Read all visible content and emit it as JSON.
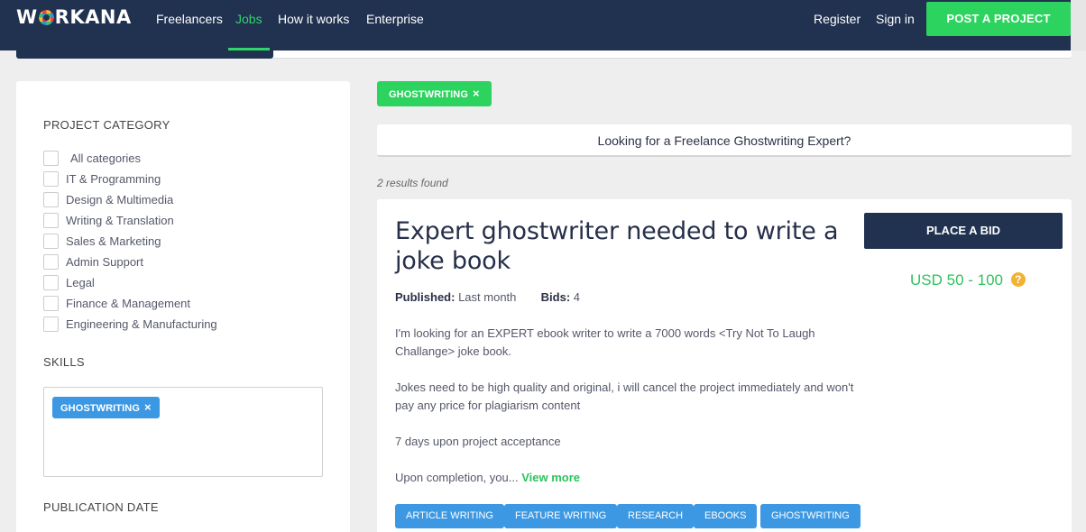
{
  "header": {
    "logo": "WORKANA",
    "nav": [
      "Freelancers",
      "Jobs",
      "How it works",
      "Enterprise"
    ],
    "register": "Register",
    "sign_in": "Sign in",
    "post_project": "POST A PROJECT"
  },
  "sidebar": {
    "category_title": "PROJECT CATEGORY",
    "categories": [
      "All categories",
      "IT & Programming",
      "Design & Multimedia",
      "Writing & Translation",
      "Sales & Marketing",
      "Admin Support",
      "Legal",
      "Finance & Management",
      "Engineering & Manufacturing"
    ],
    "skills_title": "SKILLS",
    "skill_chip": "GHOSTWRITING",
    "publication_title": "PUBLICATION DATE"
  },
  "main": {
    "filter_chip": "GHOSTWRITING",
    "cta": "Looking for a Freelance Ghostwriting Expert?",
    "results": "2 results found",
    "job": {
      "title": "Expert ghostwriter needed to write a joke book",
      "published_label": "Published:",
      "published_value": "Last month",
      "bids_label": "Bids:",
      "bids_value": "4",
      "paragraphs": [
        "I'm looking for an EXPERT ebook writer to write a 7000 words <Try Not To Laugh Challange> joke book.",
        "Jokes need to be high quality and original, i will cancel the project immediately and won't pay any price for plagiarism content",
        "7 days upon project acceptance",
        "Upon completion, you..."
      ],
      "view_more": "View more",
      "place_bid": "PLACE A BID",
      "budget": "USD 50 - 100",
      "tags": [
        "ARTICLE WRITING",
        "FEATURE WRITING",
        "RESEARCH",
        "EBOOKS",
        "GHOSTWRITING"
      ]
    }
  },
  "icons": {
    "remove": "×",
    "help": "?"
  },
  "colors": {
    "navy": "#213150",
    "green": "#2dd35f",
    "blue": "#3d98e3",
    "help": "#f2b234"
  }
}
